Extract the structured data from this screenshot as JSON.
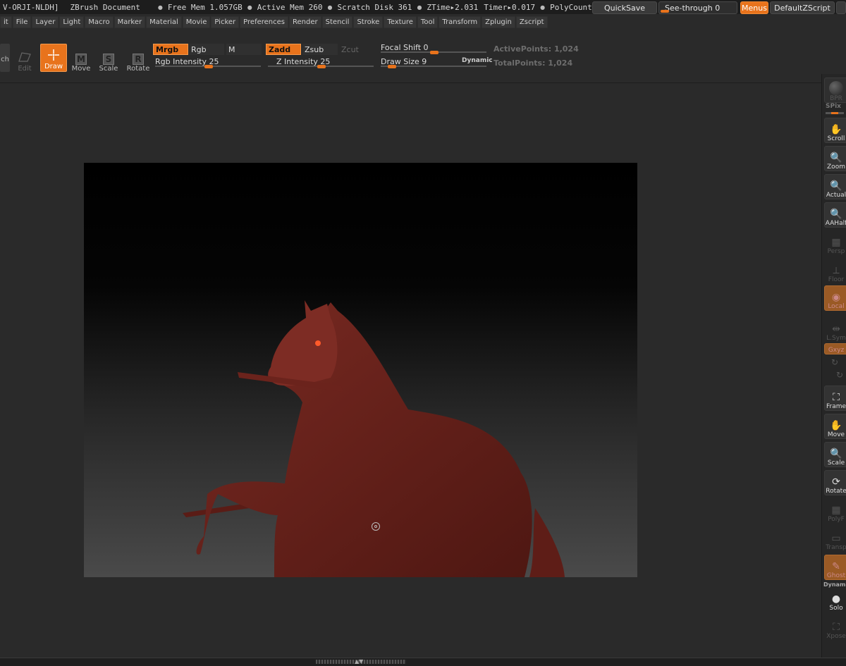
{
  "titlebar": {
    "doc_path": "V-ORJI-NLDH]",
    "doc_name": "ZBrush Document",
    "free_mem": "Free Mem 1.057GB",
    "active_mem": "Active Mem 260",
    "scratch_disk": "Scratch Disk 361",
    "ztime": "ZTime▸2.031",
    "timer": "Timer▸0.017",
    "polycount": "PolyCount",
    "quicksave": "QuickSave",
    "see_through": "See-through  0",
    "menus": "Menus",
    "default_zscript": "DefaultZScript"
  },
  "menus": [
    "it",
    "File",
    "Layer",
    "Light",
    "Macro",
    "Marker",
    "Material",
    "Movie",
    "Picker",
    "Preferences",
    "Render",
    "Stencil",
    "Stroke",
    "Texture",
    "Tool",
    "Transform",
    "Zplugin",
    "Zscript"
  ],
  "toolbar": {
    "partial": "ch",
    "edit": "Edit",
    "draw": "Draw",
    "move": "Move",
    "move_glyph": "M",
    "scale": "Scale",
    "scale_glyph": "S",
    "rotate": "Rotate",
    "rotate_glyph": "R",
    "mrgb": "Mrgb",
    "rgb": "Rgb",
    "m": "M",
    "zadd": "Zadd",
    "zsub": "Zsub",
    "zcut": "Zcut",
    "rgb_intensity": "Rgb Intensity 25",
    "z_intensity": "Z Intensity 25",
    "focal_shift": "Focal Shift 0",
    "draw_size": "Draw Size 9",
    "dynamic": "Dynamic",
    "active_points": "ActivePoints: 1,024",
    "total_points": "TotalPoints: 1,024"
  },
  "shelf": {
    "bpr": "BPR",
    "spix": "SPix",
    "scroll": "Scroll",
    "zoom": "Zoom",
    "actual": "Actual",
    "aahalf": "AAHalf",
    "persp": "Persp",
    "floor": "Floor",
    "local": "Local",
    "lsym": "L.Sym",
    "xyz": "Gxyz",
    "frame": "Frame",
    "move": "Move",
    "scale": "Scale",
    "rotate": "Rotate",
    "polyf": "PolyF",
    "transp": "Transp",
    "ghost": "Ghost",
    "dynamic": "Dynamic",
    "solo": "Solo",
    "xpose": "Xpose"
  }
}
